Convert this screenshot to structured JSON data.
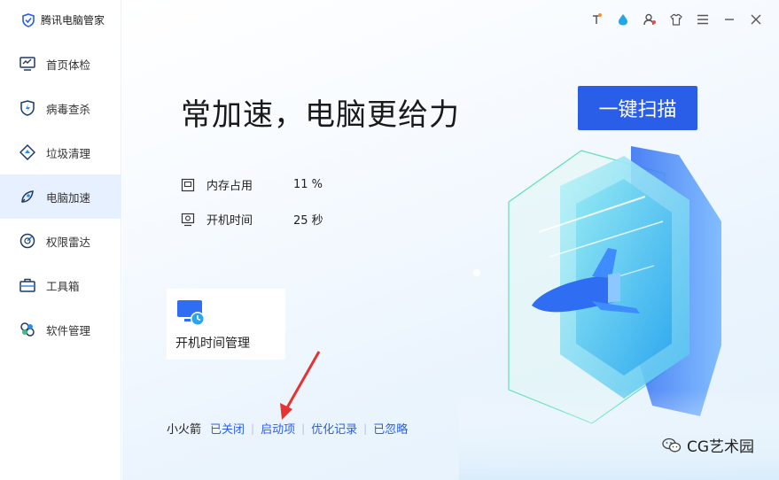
{
  "app": {
    "title": "腾讯电脑管家"
  },
  "sidebar": {
    "items": [
      {
        "label": "首页体检",
        "icon": "monitor-check-icon"
      },
      {
        "label": "病毒查杀",
        "icon": "shield-bolt-icon"
      },
      {
        "label": "垃圾清理",
        "icon": "broom-icon"
      },
      {
        "label": "电脑加速",
        "icon": "rocket-icon",
        "active": true
      },
      {
        "label": "权限雷达",
        "icon": "radar-icon"
      },
      {
        "label": "工具箱",
        "icon": "toolbox-icon"
      },
      {
        "label": "软件管理",
        "icon": "apps-icon"
      }
    ]
  },
  "main": {
    "headline": "常加速，电脑更给力",
    "scan_button": "一键扫描",
    "stats": [
      {
        "label": "内存占用",
        "value": "11 %"
      },
      {
        "label": "开机时间",
        "value": "25 秒"
      }
    ],
    "card": {
      "label": "开机时间管理"
    },
    "bottom": {
      "prefix": "小火箭",
      "links": [
        "已关闭",
        "启动项",
        "优化记录",
        "已忽略"
      ]
    }
  },
  "watermark": {
    "text": "CG艺术园"
  },
  "colors": {
    "accent": "#2a5ee8",
    "active_bg": "#e7f0ff",
    "annotation": "#e63232"
  }
}
